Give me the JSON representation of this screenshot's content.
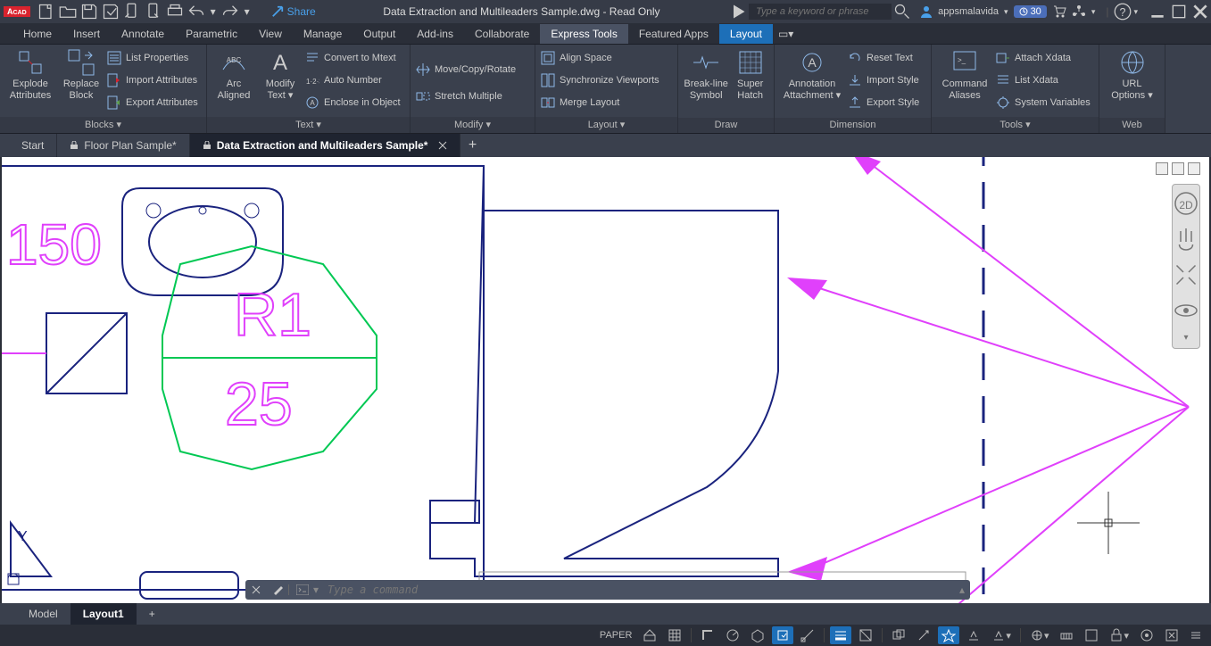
{
  "title": "Data Extraction and Multileaders Sample.dwg - Read Only",
  "share": "Share",
  "search_placeholder": "Type a keyword or phrase",
  "user": "appsmalavida",
  "trial_badge": "30",
  "menu_tabs": [
    "Home",
    "Insert",
    "Annotate",
    "Parametric",
    "View",
    "Manage",
    "Output",
    "Add-ins",
    "Collaborate",
    "Express Tools",
    "Featured Apps",
    "Layout"
  ],
  "ribbon": {
    "blocks": {
      "title": "Blocks ▾",
      "btn1": "Explode\nAttributes",
      "btn2": "Replace\nBlock",
      "items": [
        "List Properties",
        "Import Attributes",
        "Export Attributes"
      ]
    },
    "text": {
      "title": "Text ▾",
      "btn1": "Arc\nAligned",
      "btn2": "Modify\nText ▾",
      "items": [
        "Convert to Mtext",
        "Auto Number",
        "Enclose in Object"
      ]
    },
    "modify": {
      "title": "Modify ▾",
      "items": [
        "Move/Copy/Rotate",
        "Stretch Multiple"
      ]
    },
    "layout": {
      "title": "Layout ▾",
      "items": [
        "Align Space",
        "Synchronize Viewports",
        "Merge Layout"
      ]
    },
    "draw": {
      "title": "Draw",
      "btn1": "Break-line\nSymbol",
      "btn2": "Super\nHatch"
    },
    "dimension": {
      "title": "Dimension",
      "btn1": "Annotation\nAttachment ▾",
      "items": [
        "Reset Text",
        "Import Style",
        "Export Style"
      ]
    },
    "tools": {
      "title": "Tools ▾",
      "btn1": "Command\nAliases",
      "items": [
        "Attach Xdata",
        "List Xdata",
        "System Variables"
      ]
    },
    "web": {
      "title": "Web",
      "btn1": "URL\nOptions ▾"
    }
  },
  "file_tabs": {
    "start": "Start",
    "t1": "Floor Plan Sample*",
    "t2": "Data Extraction and Multileaders Sample*"
  },
  "canvas_labels": {
    "left": "150",
    "r1": "R1",
    "r2": "25",
    "y": "Y"
  },
  "cmd_placeholder": "Type a command",
  "layout_tabs": {
    "model": "Model",
    "layout1": "Layout1"
  },
  "status": {
    "paper": "PAPER"
  }
}
